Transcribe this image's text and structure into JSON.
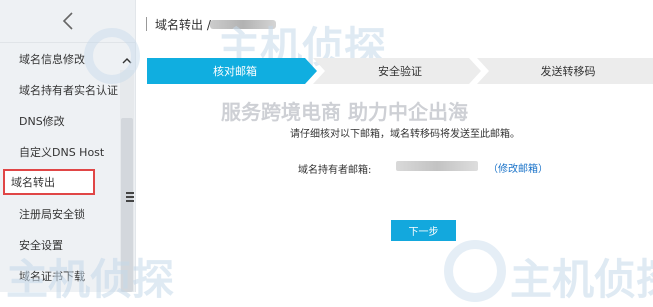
{
  "sidebar": {
    "back_label": "<",
    "items": [
      {
        "label": "域名信息修改"
      },
      {
        "label": "域名持有者实名认证"
      },
      {
        "label": "DNS修改"
      },
      {
        "label": "自定义DNS Host"
      },
      {
        "label": "域名转出"
      },
      {
        "label": "注册局安全锁"
      },
      {
        "label": "安全设置"
      },
      {
        "label": "域名证书下载"
      }
    ],
    "active_index": 4
  },
  "header": {
    "title": "域名转出 /"
  },
  "steps": [
    {
      "label": "核对邮箱",
      "state": "active"
    },
    {
      "label": "安全验证",
      "state": "pending"
    },
    {
      "label": "发送转移码",
      "state": "pending"
    }
  ],
  "main": {
    "hint": "请仔细核对以下邮箱，域名转移码将发送至此邮箱。",
    "email_label": "域名持有者邮箱:",
    "modify_link": "（修改邮箱）",
    "next_button": "下一步"
  },
  "watermark": {
    "brand": "主机侦探",
    "slogan": "服务跨境电商 助力中企出海"
  },
  "colors": {
    "accent": "#10aee0",
    "link": "#1a73c9",
    "highlight_border": "#e04646",
    "sidebar_bg": "#eef1f4"
  },
  "icons": {
    "back": "chevron-left-icon",
    "scroll_up": "chevron-up-icon",
    "collapse": "menu-collapse-icon"
  }
}
